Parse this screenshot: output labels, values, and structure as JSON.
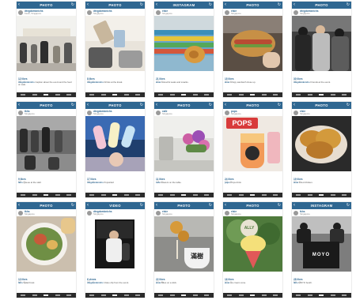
{
  "posts": [
    {
      "title": "PHOTO",
      "user": "dtvgdomknichs",
      "location": "Kiosk, Singapore",
      "likes": "12 likes",
      "caption": "Caption about the event and the food on sale.",
      "photo": "crowd-tent-icon"
    },
    {
      "title": "PHOTO",
      "user": "dtvgdomknichs",
      "location": "Singapore",
      "likes": "8 likes",
      "caption": "Drinks at the kiosk.",
      "photo": "cups-icon"
    },
    {
      "title": "INSTAGRAM",
      "user": "elsie",
      "location": "Singapore",
      "likes": "21 likes",
      "caption": "Colourful seats and snacks.",
      "photo": "seats-snack-icon"
    },
    {
      "title": "PHOTO",
      "user": "elsie",
      "location": "Singapore",
      "likes": "15 likes",
      "caption": "Crispy sandwich close up.",
      "photo": "sandwich-icon"
    },
    {
      "title": "PHOTO",
      "user": "dtvgdomknichs",
      "location": "Singapore",
      "likes": "30 likes",
      "caption": "Friends at the event.",
      "photo": "people-icon"
    },
    {
      "title": "PHOTO",
      "user": "tkhs",
      "location": "Singapore",
      "likes": "9 likes",
      "caption": "Queue at the stall.",
      "photo": "queue-icon"
    },
    {
      "title": "PHOTO",
      "user": "dtvgdomknichs",
      "location": "Singapore",
      "likes": "17 likes",
      "caption": "Popsicles!",
      "photo": "popsicle-icon"
    },
    {
      "title": "PHOTO",
      "user": "cafe",
      "location": "Singapore",
      "likes": "11 likes",
      "caption": "Flowers on the table.",
      "photo": "flowers-icon"
    },
    {
      "title": "PHOTO",
      "user": "pops",
      "location": "Singapore",
      "likes": "24 likes",
      "caption": "Pops drink.",
      "photo": "pops-drink-icon"
    },
    {
      "title": "PHOTO",
      "user": "elsie",
      "location": "Singapore",
      "likes": "19 likes",
      "caption": "Fried chicken.",
      "photo": "chicken-icon"
    },
    {
      "title": "PHOTO",
      "user": "tkhs",
      "location": "Singapore",
      "likes": "13 likes",
      "caption": "Salad bowl.",
      "photo": "bowl-icon"
    },
    {
      "title": "VIDEO",
      "user": "dtvgdomknichs",
      "location": "Singapore",
      "likes": "6 views",
      "caption": "Video clip from the event.",
      "photo": "video-icon"
    },
    {
      "title": "PHOTO",
      "user": "elsie",
      "location": "Singapore",
      "likes": "22 likes",
      "caption": "Bites on a stick.",
      "photo": "skewer-icon"
    },
    {
      "title": "PHOTO",
      "user": "elsie",
      "location": "Singapore",
      "likes": "16 likes",
      "caption": "Ice cream cone.",
      "photo": "icecream-icon"
    },
    {
      "title": "INSTAGRAM",
      "user": "tkhs",
      "location": "Singapore",
      "likes": "28 likes",
      "caption": "MOYO booth.",
      "photo": "moyo-icon"
    }
  ],
  "misc": {
    "pops_sign": "POPS",
    "moyo_sign": "MOYO",
    "fresh_label": "ALLY",
    "bowl_label": "滿樹"
  }
}
